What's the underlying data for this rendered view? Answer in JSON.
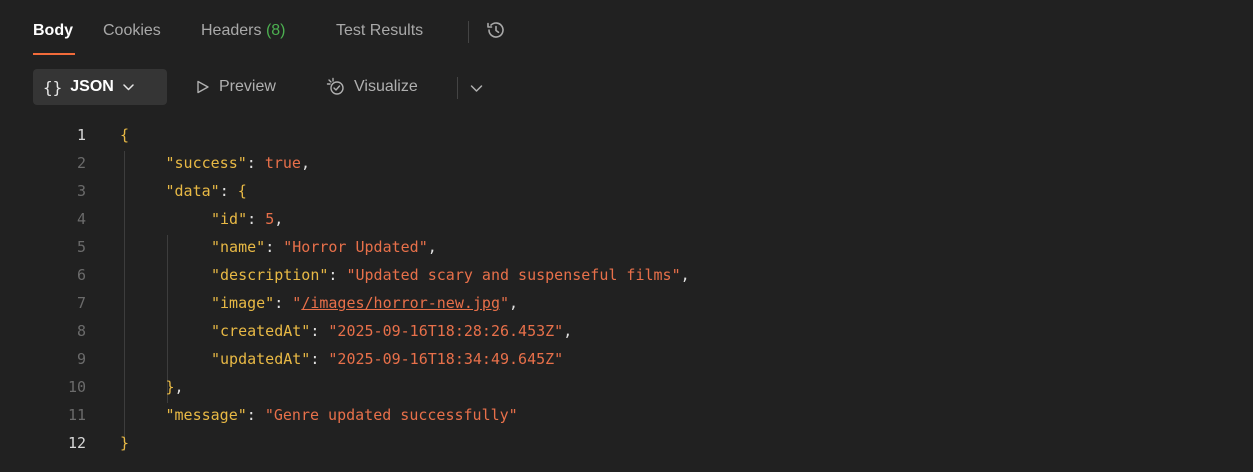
{
  "tabs": [
    {
      "label": "Body",
      "active": true
    },
    {
      "label": "Cookies"
    },
    {
      "label": "Headers",
      "count": "(8)"
    },
    {
      "label": "Test Results"
    }
  ],
  "toolbar": {
    "format_braces": "{}",
    "format_label": "JSON",
    "preview_label": "Preview",
    "visualize_label": "Visualize"
  },
  "colors": {
    "accent": "#f26b3a",
    "count_green": "#4caf50",
    "key_yellow": "#e8b945",
    "value_orange": "#e8704a"
  },
  "icons": [
    "history-icon",
    "chevron-down-icon",
    "play-icon",
    "visualize-icon"
  ],
  "code": {
    "line_numbers": [
      "1",
      "2",
      "3",
      "4",
      "5",
      "6",
      "7",
      "8",
      "9",
      "10",
      "11",
      "12"
    ],
    "lines": [
      {
        "indent": 0,
        "tokens": [
          {
            "t": "{",
            "c": "brace"
          }
        ]
      },
      {
        "indent": 1,
        "tokens": [
          {
            "t": "\"success\"",
            "c": "k"
          },
          {
            "t": ": ",
            "c": "p"
          },
          {
            "t": "true",
            "c": "b"
          },
          {
            "t": ",",
            "c": "p"
          }
        ]
      },
      {
        "indent": 1,
        "tokens": [
          {
            "t": "\"data\"",
            "c": "k"
          },
          {
            "t": ": ",
            "c": "p"
          },
          {
            "t": "{",
            "c": "brace"
          }
        ]
      },
      {
        "indent": 2,
        "tokens": [
          {
            "t": "\"id\"",
            "c": "k"
          },
          {
            "t": ": ",
            "c": "p"
          },
          {
            "t": "5",
            "c": "n"
          },
          {
            "t": ",",
            "c": "p"
          }
        ]
      },
      {
        "indent": 2,
        "tokens": [
          {
            "t": "\"name\"",
            "c": "k"
          },
          {
            "t": ": ",
            "c": "p"
          },
          {
            "t": "\"Horror Updated\"",
            "c": "s"
          },
          {
            "t": ",",
            "c": "p"
          }
        ]
      },
      {
        "indent": 2,
        "tokens": [
          {
            "t": "\"description\"",
            "c": "k"
          },
          {
            "t": ": ",
            "c": "p"
          },
          {
            "t": "\"Updated scary and suspenseful films\"",
            "c": "s"
          },
          {
            "t": ",",
            "c": "p"
          }
        ]
      },
      {
        "indent": 2,
        "tokens": [
          {
            "t": "\"image\"",
            "c": "k"
          },
          {
            "t": ": ",
            "c": "p"
          },
          {
            "t": "\"",
            "c": "s"
          },
          {
            "t": "/images/horror-new.jpg",
            "c": "s u"
          },
          {
            "t": "\"",
            "c": "s"
          },
          {
            "t": ",",
            "c": "p"
          }
        ]
      },
      {
        "indent": 2,
        "tokens": [
          {
            "t": "\"createdAt\"",
            "c": "k"
          },
          {
            "t": ": ",
            "c": "p"
          },
          {
            "t": "\"2025-09-16T18:28:26.453Z\"",
            "c": "s"
          },
          {
            "t": ",",
            "c": "p"
          }
        ]
      },
      {
        "indent": 2,
        "tokens": [
          {
            "t": "\"updatedAt\"",
            "c": "k"
          },
          {
            "t": ": ",
            "c": "p"
          },
          {
            "t": "\"2025-09-16T18:34:49.645Z\"",
            "c": "s"
          }
        ]
      },
      {
        "indent": 1,
        "tokens": [
          {
            "t": "}",
            "c": "brace"
          },
          {
            "t": ",",
            "c": "p"
          }
        ]
      },
      {
        "indent": 1,
        "tokens": [
          {
            "t": "\"message\"",
            "c": "k"
          },
          {
            "t": ": ",
            "c": "p"
          },
          {
            "t": "\"Genre updated successfully\"",
            "c": "s"
          }
        ]
      },
      {
        "indent": 0,
        "tokens": [
          {
            "t": "}",
            "c": "brace"
          }
        ]
      }
    ]
  }
}
